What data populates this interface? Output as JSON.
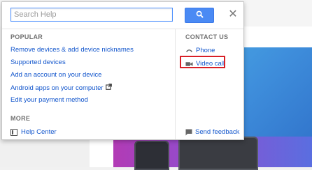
{
  "search": {
    "placeholder": "Search Help",
    "value": ""
  },
  "popular": {
    "heading": "POPULAR",
    "links": [
      "Remove devices & add device nicknames",
      "Supported devices",
      "Add an account on your device",
      "Android apps on your computer",
      "Edit your payment method"
    ]
  },
  "more": {
    "heading": "MORE",
    "help_center": "Help Center"
  },
  "contact": {
    "heading": "CONTACT US",
    "phone": "Phone",
    "video_call": "Video call",
    "send_feedback": "Send feedback"
  },
  "colors": {
    "link": "#1155cc",
    "search_button": "#4a8af4",
    "highlight": "#d81f26"
  }
}
